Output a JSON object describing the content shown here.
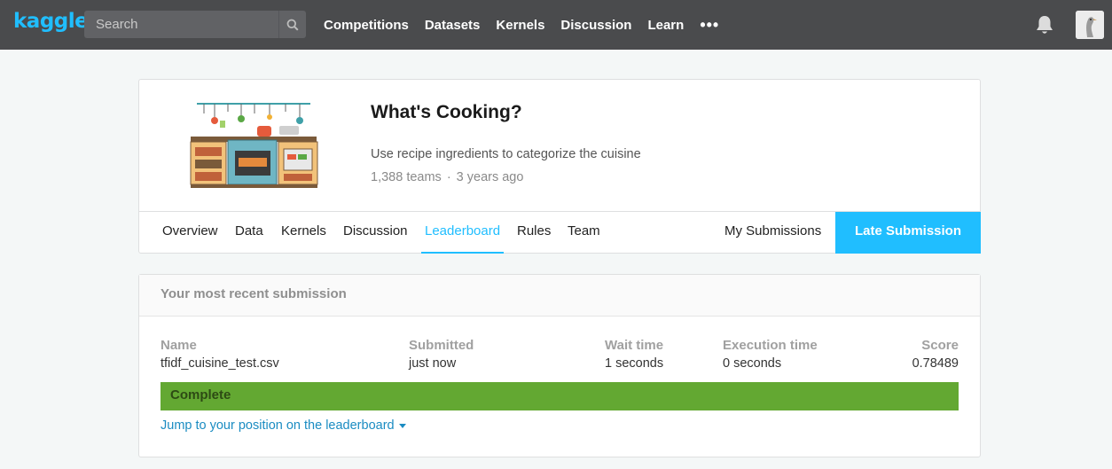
{
  "app": {
    "logo_text": "kaggle",
    "brand_color": "#20beff"
  },
  "topbar": {
    "search_placeholder": "Search",
    "nav": [
      "Competitions",
      "Datasets",
      "Kernels",
      "Discussion",
      "Learn"
    ],
    "more_label": "•••"
  },
  "competition": {
    "title": "What's Cooking?",
    "subtitle": "Use recipe ingredients to categorize the cuisine",
    "teams": "1,388 teams",
    "meta_sep": "·",
    "age": "3 years ago",
    "tabs": [
      "Overview",
      "Data",
      "Kernels",
      "Discussion",
      "Leaderboard",
      "Rules",
      "Team"
    ],
    "active_tab": "Leaderboard",
    "my_submissions": "My Submissions",
    "late_submission": "Late Submission"
  },
  "submission": {
    "header": "Your most recent submission",
    "columns": {
      "name": "Name",
      "submitted": "Submitted",
      "wait": "Wait time",
      "exec": "Execution time",
      "score": "Score"
    },
    "values": {
      "name": "tfidf_cuisine_test.csv",
      "submitted": "just now",
      "wait": "1 seconds",
      "exec": "0 seconds",
      "score": "0.78489"
    },
    "status": "Complete",
    "status_color": "#63a832",
    "jump_link": "Jump to your position on the leaderboard"
  }
}
